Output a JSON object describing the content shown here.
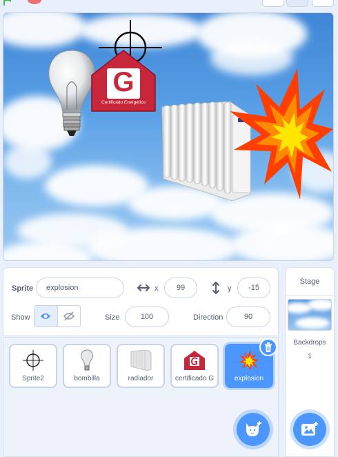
{
  "stage_sprites": {
    "certificate_letter": "G",
    "certificate_text": "Certificado Energetico"
  },
  "sprite_info": {
    "sprite_label": "Sprite",
    "sprite_name": "explosion",
    "x_label": "x",
    "x_value": "99",
    "y_label": "y",
    "y_value": "-15",
    "show_label": "Show",
    "size_label": "Size",
    "size_value": "100",
    "direction_label": "Direction",
    "direction_value": "90"
  },
  "sprites": [
    {
      "name": "Sprite2",
      "icon": "crosshair-icon",
      "selected": false
    },
    {
      "name": "bombilla",
      "icon": "lightbulb-icon",
      "selected": false
    },
    {
      "name": "radiador",
      "icon": "radiator-icon",
      "selected": false
    },
    {
      "name": "certificado G",
      "icon": "certificate-icon",
      "selected": false
    },
    {
      "name": "explosion",
      "icon": "explosion-icon",
      "selected": true
    }
  ],
  "stage_panel": {
    "title": "Stage",
    "backdrops_label": "Backdrops",
    "backdrops_count": "1"
  },
  "colors": {
    "accent": "#4c97ff",
    "certificate_red": "#c8263a",
    "explosion_orange": "#ff4b00",
    "explosion_yellow": "#ffe600"
  }
}
